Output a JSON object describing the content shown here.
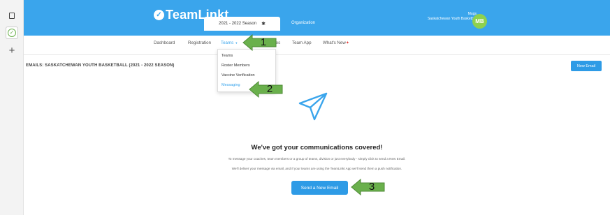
{
  "app": {
    "name": "TeamLinkt"
  },
  "header": {
    "season_tab": "2021 - 2022 Season",
    "org_tab": "Organization",
    "user_name": "Mugs",
    "user_org": "Saskatchewan Youth Basketb...",
    "avatar_initials": "MB"
  },
  "subnav": {
    "items": [
      {
        "label": "Dashboard"
      },
      {
        "label": "Registration"
      },
      {
        "label": "Teams"
      },
      {
        "label": "Scores"
      },
      {
        "label": "Team App"
      },
      {
        "label": "What's New"
      }
    ]
  },
  "dropdown": {
    "items": [
      {
        "label": "Teams"
      },
      {
        "label": "Roster Members"
      },
      {
        "label": "Vaccine Verification"
      },
      {
        "label": "Messaging"
      }
    ]
  },
  "page": {
    "title": "EMAILS: SASKATCHEWAN YOUTH BASKETBALL (2021 - 2022 SEASON)",
    "new_email_label": "New Email"
  },
  "empty_state": {
    "heading": "We've got your communications covered!",
    "line1": "To message your coaches, team members or a group of teams, division or just everybody - simply click to send a New Email.",
    "line2": "We'll deliver your message via email, and if your teams are using the TeamLinkt App we'll send them a push notification.",
    "button_label": "Send a New Email"
  },
  "callouts": [
    {
      "number": "1"
    },
    {
      "number": "2"
    },
    {
      "number": "3"
    }
  ],
  "icons": {
    "rail": [
      "copy-icon",
      "check-circle-icon",
      "plus-icon"
    ],
    "settings": "gear-icon",
    "empty_state": "paper-plane-icon"
  },
  "colors": {
    "brand_blue": "#3aa5ec",
    "button_blue": "#2e9be6",
    "avatar_green": "#8ed14f",
    "callout_green": "#6ab04c"
  }
}
